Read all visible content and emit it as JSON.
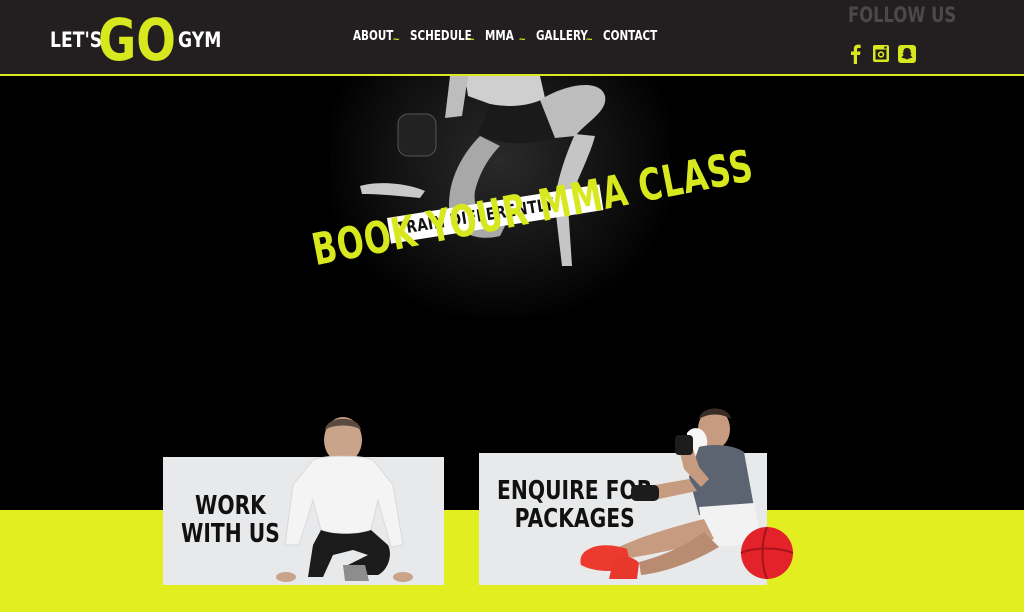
{
  "brand": {
    "lets": "LET'S",
    "go": "GO",
    "gym": "GYM",
    "accent": "#d7e81f"
  },
  "nav": {
    "items": [
      "ABOUT",
      "SCHEDULE",
      "MMA",
      "GALLERY",
      "CONTACT"
    ],
    "separator": "~"
  },
  "follow": {
    "title": "FOLLOW US",
    "icons": [
      "facebook-icon",
      "instagram-icon",
      "snapchat-icon"
    ]
  },
  "hero": {
    "tagline": "TRAIN DIFFERENTLY",
    "title": "BOOK YOUR MMA CLASS"
  },
  "cards": [
    {
      "line1": "WORK",
      "line2": "WITH US"
    },
    {
      "line1": "ENQUIRE FOR",
      "line2": "PACKAGES"
    }
  ],
  "colors": {
    "header": "#231f20",
    "accent": "#d7e81f",
    "band": "#e3ee21",
    "card": "#e8e9ea"
  }
}
